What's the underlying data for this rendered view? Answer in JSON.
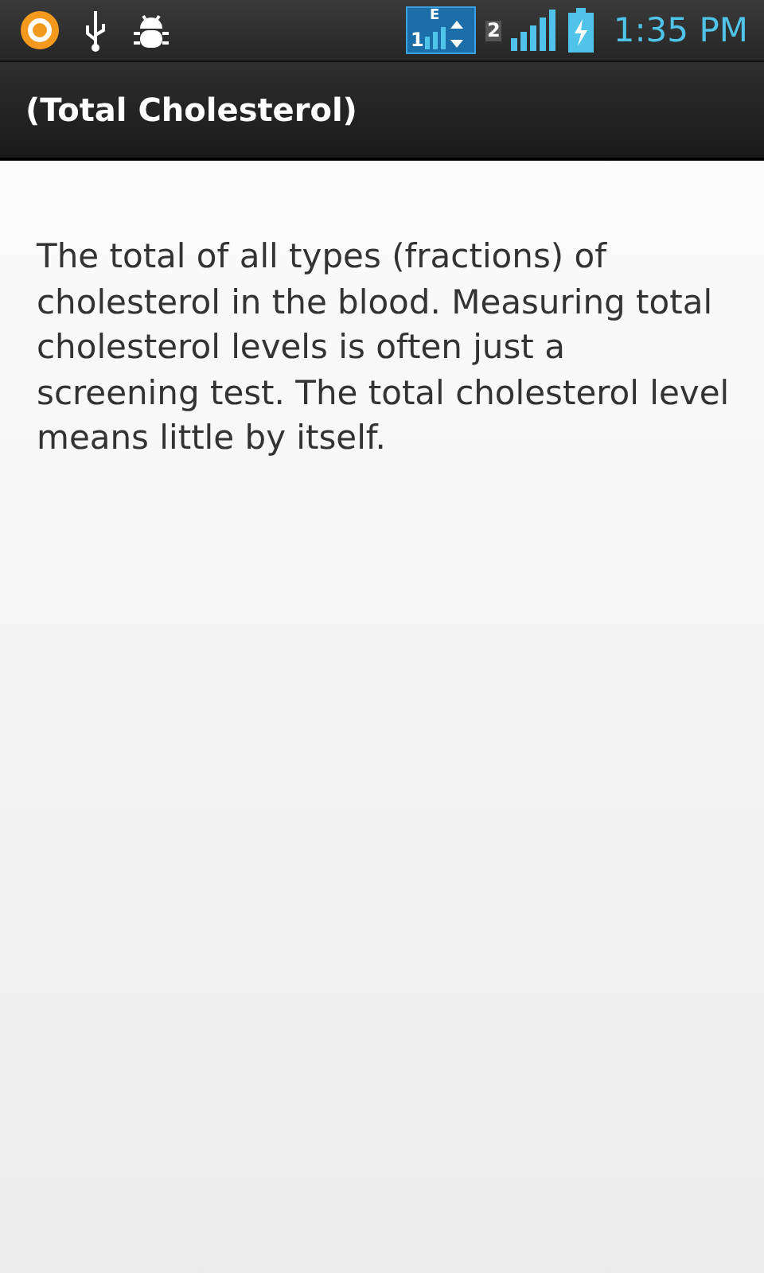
{
  "status_bar": {
    "sim1": {
      "network": "E",
      "slot": "1"
    },
    "sim2": {
      "slot": "2"
    },
    "time": "1:35 PM"
  },
  "title_bar": {
    "title": "(Total Cholesterol)"
  },
  "content": {
    "text": "The total of all types (fractions) of cholesterol in the blood. Measuring total cholesterol levels is often just a screening test. The total cholesterol level means little by itself."
  }
}
